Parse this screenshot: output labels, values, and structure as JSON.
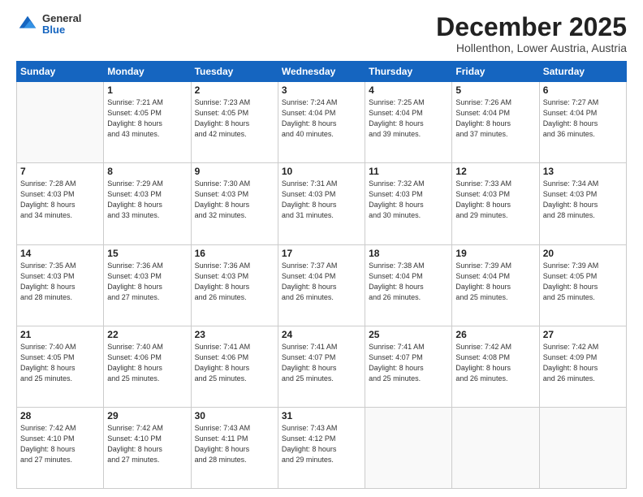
{
  "header": {
    "logo": {
      "general": "General",
      "blue": "Blue"
    },
    "title": "December 2025",
    "subtitle": "Hollenthon, Lower Austria, Austria"
  },
  "calendar": {
    "weekdays": [
      "Sunday",
      "Monday",
      "Tuesday",
      "Wednesday",
      "Thursday",
      "Friday",
      "Saturday"
    ],
    "weeks": [
      [
        {
          "day": "",
          "info": ""
        },
        {
          "day": "1",
          "info": "Sunrise: 7:21 AM\nSunset: 4:05 PM\nDaylight: 8 hours\nand 43 minutes."
        },
        {
          "day": "2",
          "info": "Sunrise: 7:23 AM\nSunset: 4:05 PM\nDaylight: 8 hours\nand 42 minutes."
        },
        {
          "day": "3",
          "info": "Sunrise: 7:24 AM\nSunset: 4:04 PM\nDaylight: 8 hours\nand 40 minutes."
        },
        {
          "day": "4",
          "info": "Sunrise: 7:25 AM\nSunset: 4:04 PM\nDaylight: 8 hours\nand 39 minutes."
        },
        {
          "day": "5",
          "info": "Sunrise: 7:26 AM\nSunset: 4:04 PM\nDaylight: 8 hours\nand 37 minutes."
        },
        {
          "day": "6",
          "info": "Sunrise: 7:27 AM\nSunset: 4:04 PM\nDaylight: 8 hours\nand 36 minutes."
        }
      ],
      [
        {
          "day": "7",
          "info": "Sunrise: 7:28 AM\nSunset: 4:03 PM\nDaylight: 8 hours\nand 34 minutes."
        },
        {
          "day": "8",
          "info": "Sunrise: 7:29 AM\nSunset: 4:03 PM\nDaylight: 8 hours\nand 33 minutes."
        },
        {
          "day": "9",
          "info": "Sunrise: 7:30 AM\nSunset: 4:03 PM\nDaylight: 8 hours\nand 32 minutes."
        },
        {
          "day": "10",
          "info": "Sunrise: 7:31 AM\nSunset: 4:03 PM\nDaylight: 8 hours\nand 31 minutes."
        },
        {
          "day": "11",
          "info": "Sunrise: 7:32 AM\nSunset: 4:03 PM\nDaylight: 8 hours\nand 30 minutes."
        },
        {
          "day": "12",
          "info": "Sunrise: 7:33 AM\nSunset: 4:03 PM\nDaylight: 8 hours\nand 29 minutes."
        },
        {
          "day": "13",
          "info": "Sunrise: 7:34 AM\nSunset: 4:03 PM\nDaylight: 8 hours\nand 28 minutes."
        }
      ],
      [
        {
          "day": "14",
          "info": "Sunrise: 7:35 AM\nSunset: 4:03 PM\nDaylight: 8 hours\nand 28 minutes."
        },
        {
          "day": "15",
          "info": "Sunrise: 7:36 AM\nSunset: 4:03 PM\nDaylight: 8 hours\nand 27 minutes."
        },
        {
          "day": "16",
          "info": "Sunrise: 7:36 AM\nSunset: 4:03 PM\nDaylight: 8 hours\nand 26 minutes."
        },
        {
          "day": "17",
          "info": "Sunrise: 7:37 AM\nSunset: 4:04 PM\nDaylight: 8 hours\nand 26 minutes."
        },
        {
          "day": "18",
          "info": "Sunrise: 7:38 AM\nSunset: 4:04 PM\nDaylight: 8 hours\nand 26 minutes."
        },
        {
          "day": "19",
          "info": "Sunrise: 7:39 AM\nSunset: 4:04 PM\nDaylight: 8 hours\nand 25 minutes."
        },
        {
          "day": "20",
          "info": "Sunrise: 7:39 AM\nSunset: 4:05 PM\nDaylight: 8 hours\nand 25 minutes."
        }
      ],
      [
        {
          "day": "21",
          "info": "Sunrise: 7:40 AM\nSunset: 4:05 PM\nDaylight: 8 hours\nand 25 minutes."
        },
        {
          "day": "22",
          "info": "Sunrise: 7:40 AM\nSunset: 4:06 PM\nDaylight: 8 hours\nand 25 minutes."
        },
        {
          "day": "23",
          "info": "Sunrise: 7:41 AM\nSunset: 4:06 PM\nDaylight: 8 hours\nand 25 minutes."
        },
        {
          "day": "24",
          "info": "Sunrise: 7:41 AM\nSunset: 4:07 PM\nDaylight: 8 hours\nand 25 minutes."
        },
        {
          "day": "25",
          "info": "Sunrise: 7:41 AM\nSunset: 4:07 PM\nDaylight: 8 hours\nand 25 minutes."
        },
        {
          "day": "26",
          "info": "Sunrise: 7:42 AM\nSunset: 4:08 PM\nDaylight: 8 hours\nand 26 minutes."
        },
        {
          "day": "27",
          "info": "Sunrise: 7:42 AM\nSunset: 4:09 PM\nDaylight: 8 hours\nand 26 minutes."
        }
      ],
      [
        {
          "day": "28",
          "info": "Sunrise: 7:42 AM\nSunset: 4:10 PM\nDaylight: 8 hours\nand 27 minutes."
        },
        {
          "day": "29",
          "info": "Sunrise: 7:42 AM\nSunset: 4:10 PM\nDaylight: 8 hours\nand 27 minutes."
        },
        {
          "day": "30",
          "info": "Sunrise: 7:43 AM\nSunset: 4:11 PM\nDaylight: 8 hours\nand 28 minutes."
        },
        {
          "day": "31",
          "info": "Sunrise: 7:43 AM\nSunset: 4:12 PM\nDaylight: 8 hours\nand 29 minutes."
        },
        {
          "day": "",
          "info": ""
        },
        {
          "day": "",
          "info": ""
        },
        {
          "day": "",
          "info": ""
        }
      ]
    ]
  }
}
